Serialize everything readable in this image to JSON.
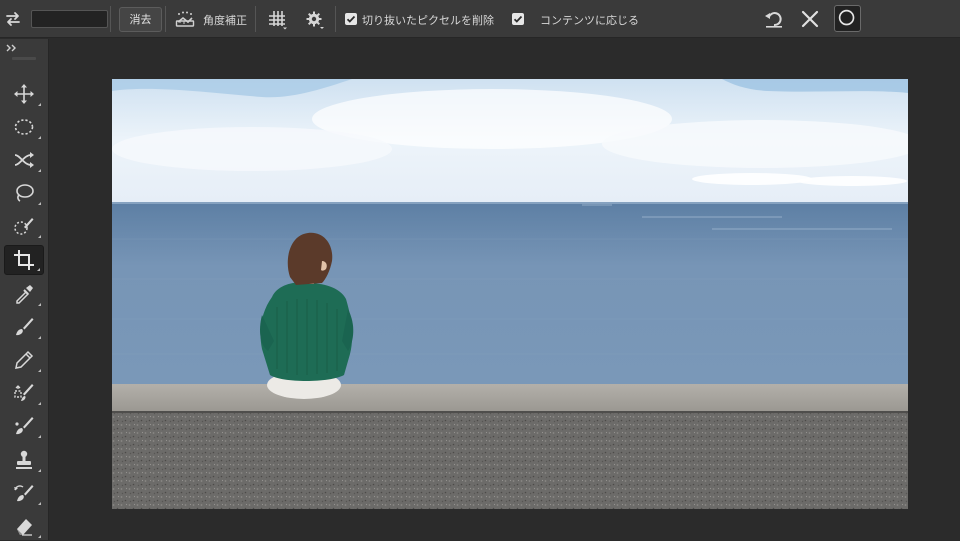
{
  "options_bar": {
    "ratio_value": "",
    "clear_label": "消去",
    "straighten_label": "角度補正",
    "delete_cropped_pixels": {
      "label": "切り抜いたピクセルを削除",
      "checked": true
    },
    "content_aware": {
      "label": "コンテンツに応じる",
      "checked": true
    }
  },
  "toolbar": {
    "tools": [
      {
        "name": "move-tool",
        "icon": "move-icon"
      },
      {
        "name": "marquee-tool",
        "icon": "elliptical-marquee-icon"
      },
      {
        "name": "path-selection-tool",
        "icon": "path-selection-icon"
      },
      {
        "name": "lasso-tool",
        "icon": "lasso-icon"
      },
      {
        "name": "quick-selection-tool",
        "icon": "quick-selection-icon"
      },
      {
        "name": "crop-tool",
        "icon": "crop-icon",
        "active": true
      },
      {
        "name": "eyedropper-tool",
        "icon": "eyedropper-icon"
      },
      {
        "name": "brush-tool",
        "icon": "brush-icon"
      },
      {
        "name": "pencil-tool",
        "icon": "pencil-icon"
      },
      {
        "name": "content-aware-move-tool",
        "icon": "content-aware-move-icon"
      },
      {
        "name": "healing-brush-tool",
        "icon": "healing-brush-icon"
      },
      {
        "name": "clone-stamp-tool",
        "icon": "stamp-icon"
      },
      {
        "name": "history-brush-tool",
        "icon": "history-brush-icon"
      },
      {
        "name": "eraser-tool",
        "icon": "eraser-icon"
      }
    ]
  },
  "colors": {
    "panel": "#3a3a3a",
    "workspace": "#2b2b2b",
    "sky": "#dbe8f4",
    "sea": "#6f8eae",
    "sweater": "#1f6e55",
    "wall": "#6b6b6b"
  }
}
